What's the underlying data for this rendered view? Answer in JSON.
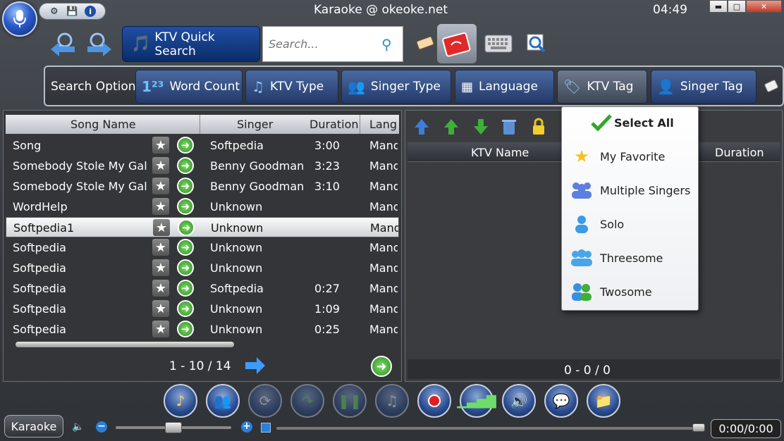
{
  "window": {
    "title": "Karaoke @ okeoke.net",
    "clock": "04:49",
    "min_label": "▬",
    "max_label": "□",
    "close_label": "✕"
  },
  "toolbar": {
    "ktv_quick_search": "KTV Quick Search",
    "search_placeholder": "Search..."
  },
  "search_option": {
    "label": "Search Option",
    "buttons": [
      "Word Count",
      "KTV Type",
      "Singer Type",
      "Language",
      "KTV Tag",
      "Singer Tag"
    ]
  },
  "song_table": {
    "headers": [
      "Song Name",
      "Singer",
      "Duration",
      "Lang"
    ],
    "rows": [
      {
        "name": "Song",
        "singer": "Softpedia",
        "duration": "3:00",
        "lang": "Mand"
      },
      {
        "name": "Somebody Stole My Gal",
        "singer": "Benny Goodman",
        "duration": "3:23",
        "lang": "Mand"
      },
      {
        "name": "Somebody Stole My Gal",
        "singer": "Benny Goodman",
        "duration": "3:10",
        "lang": "Mand"
      },
      {
        "name": "WordHelp",
        "singer": "Unknown",
        "duration": "",
        "lang": "Mand"
      },
      {
        "name": "Softpedia1",
        "singer": "Unknown",
        "duration": "",
        "lang": "Mand"
      },
      {
        "name": "Softpedia",
        "singer": "Unknown",
        "duration": "",
        "lang": "Mand"
      },
      {
        "name": "Softpedia",
        "singer": "Unknown",
        "duration": "",
        "lang": "Mand"
      },
      {
        "name": "Softpedia",
        "singer": "Softpedia",
        "duration": "0:27",
        "lang": "Mand"
      },
      {
        "name": "Softpedia",
        "singer": "Unknown",
        "duration": "1:09",
        "lang": "Mand"
      },
      {
        "name": "Softpedia",
        "singer": "Unknown",
        "duration": "0:25",
        "lang": "Mand"
      }
    ],
    "pager_text": "1  - 10 / 14"
  },
  "playlist": {
    "headers": [
      "KTV Name",
      "Duration"
    ],
    "pager_text": "0  - 0  / 0"
  },
  "ktv_tag_menu": {
    "select_all": "Select All",
    "items": [
      "My Favorite",
      "Multiple Singers",
      "Solo",
      "Threesome",
      "Twosome"
    ]
  },
  "bottom": {
    "karaoke_label": "Karaoke",
    "time": "0:00/0:00"
  },
  "colors": {
    "accent": "#1f4fa4",
    "background": "#3a3e43"
  }
}
